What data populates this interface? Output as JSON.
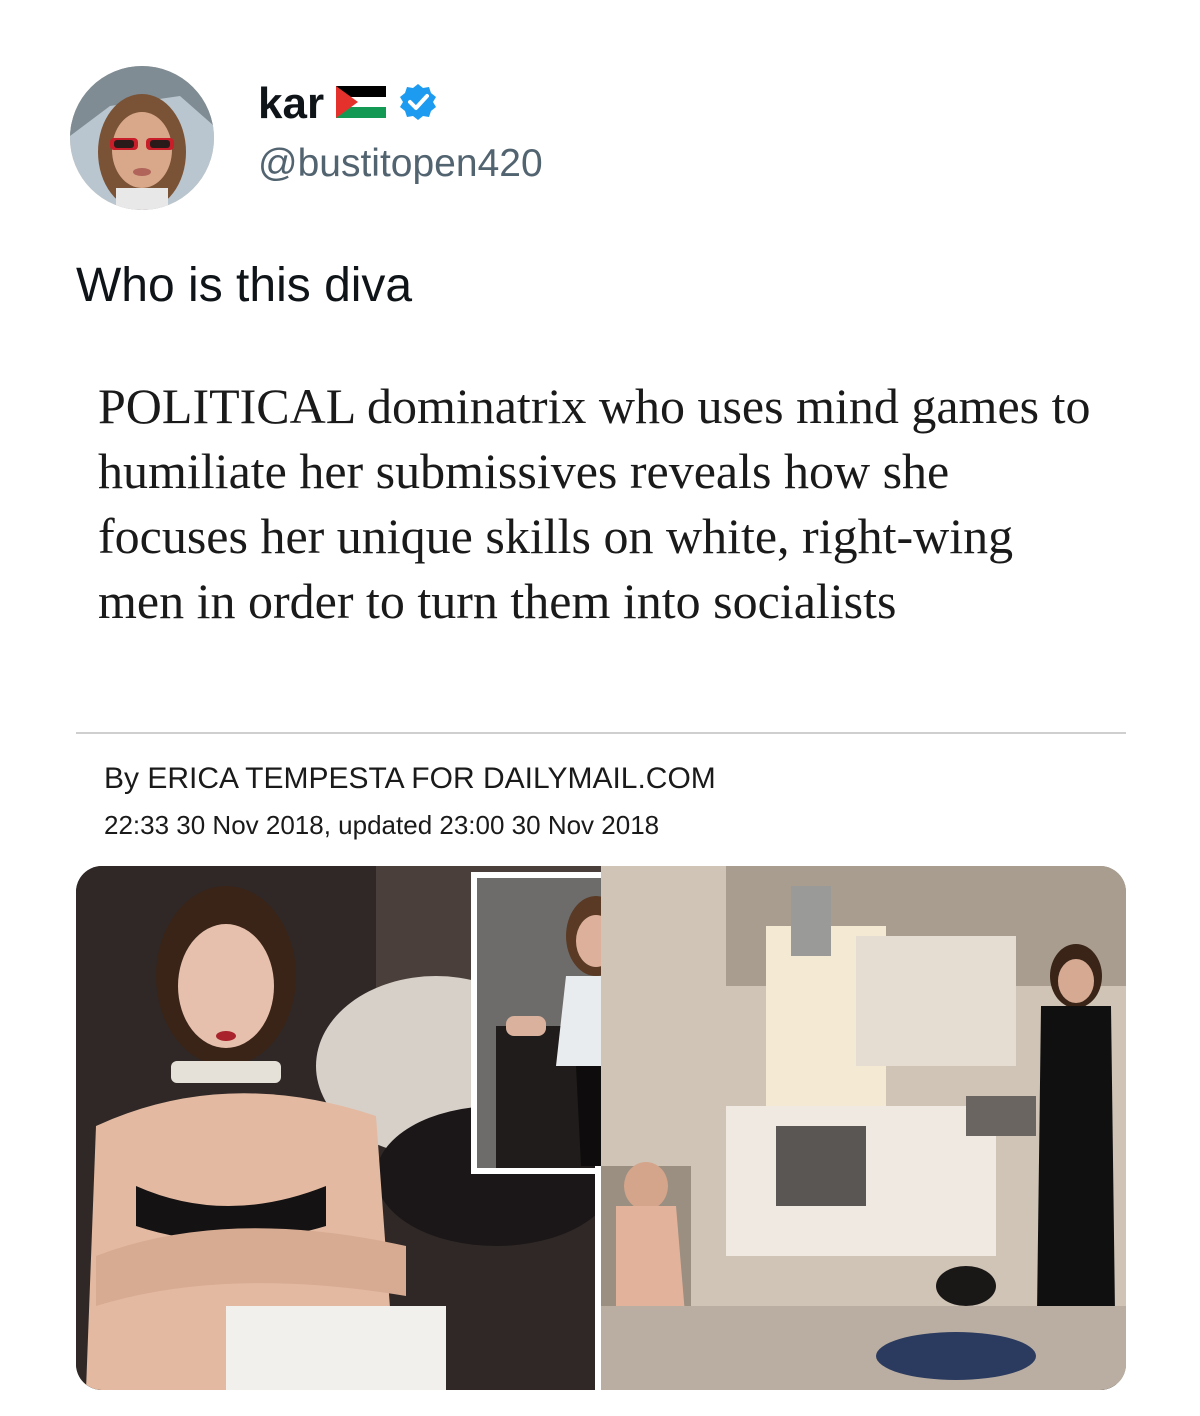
{
  "tweet": {
    "author": {
      "display_name": "kar",
      "handle": "@bustitopen420"
    },
    "icons": [
      "palestine-flag-icon",
      "verified-badge-icon"
    ],
    "text": "Who is this diva",
    "media": {
      "headline": "POLITICAL dominatrix who uses mind games to humiliate her submissives reveals how she focuses her unique skills on white, right-wing men in order to turn them into socialists",
      "byline": "By ERICA TEMPESTA FOR DAILYMAIL.COM",
      "timestamp": "22:33 30 Nov 2018, updated 23:00 30 Nov 2018"
    },
    "colors": {
      "verified": "#1d9bf0",
      "handle": "#536471",
      "text": "#0f1419"
    }
  }
}
